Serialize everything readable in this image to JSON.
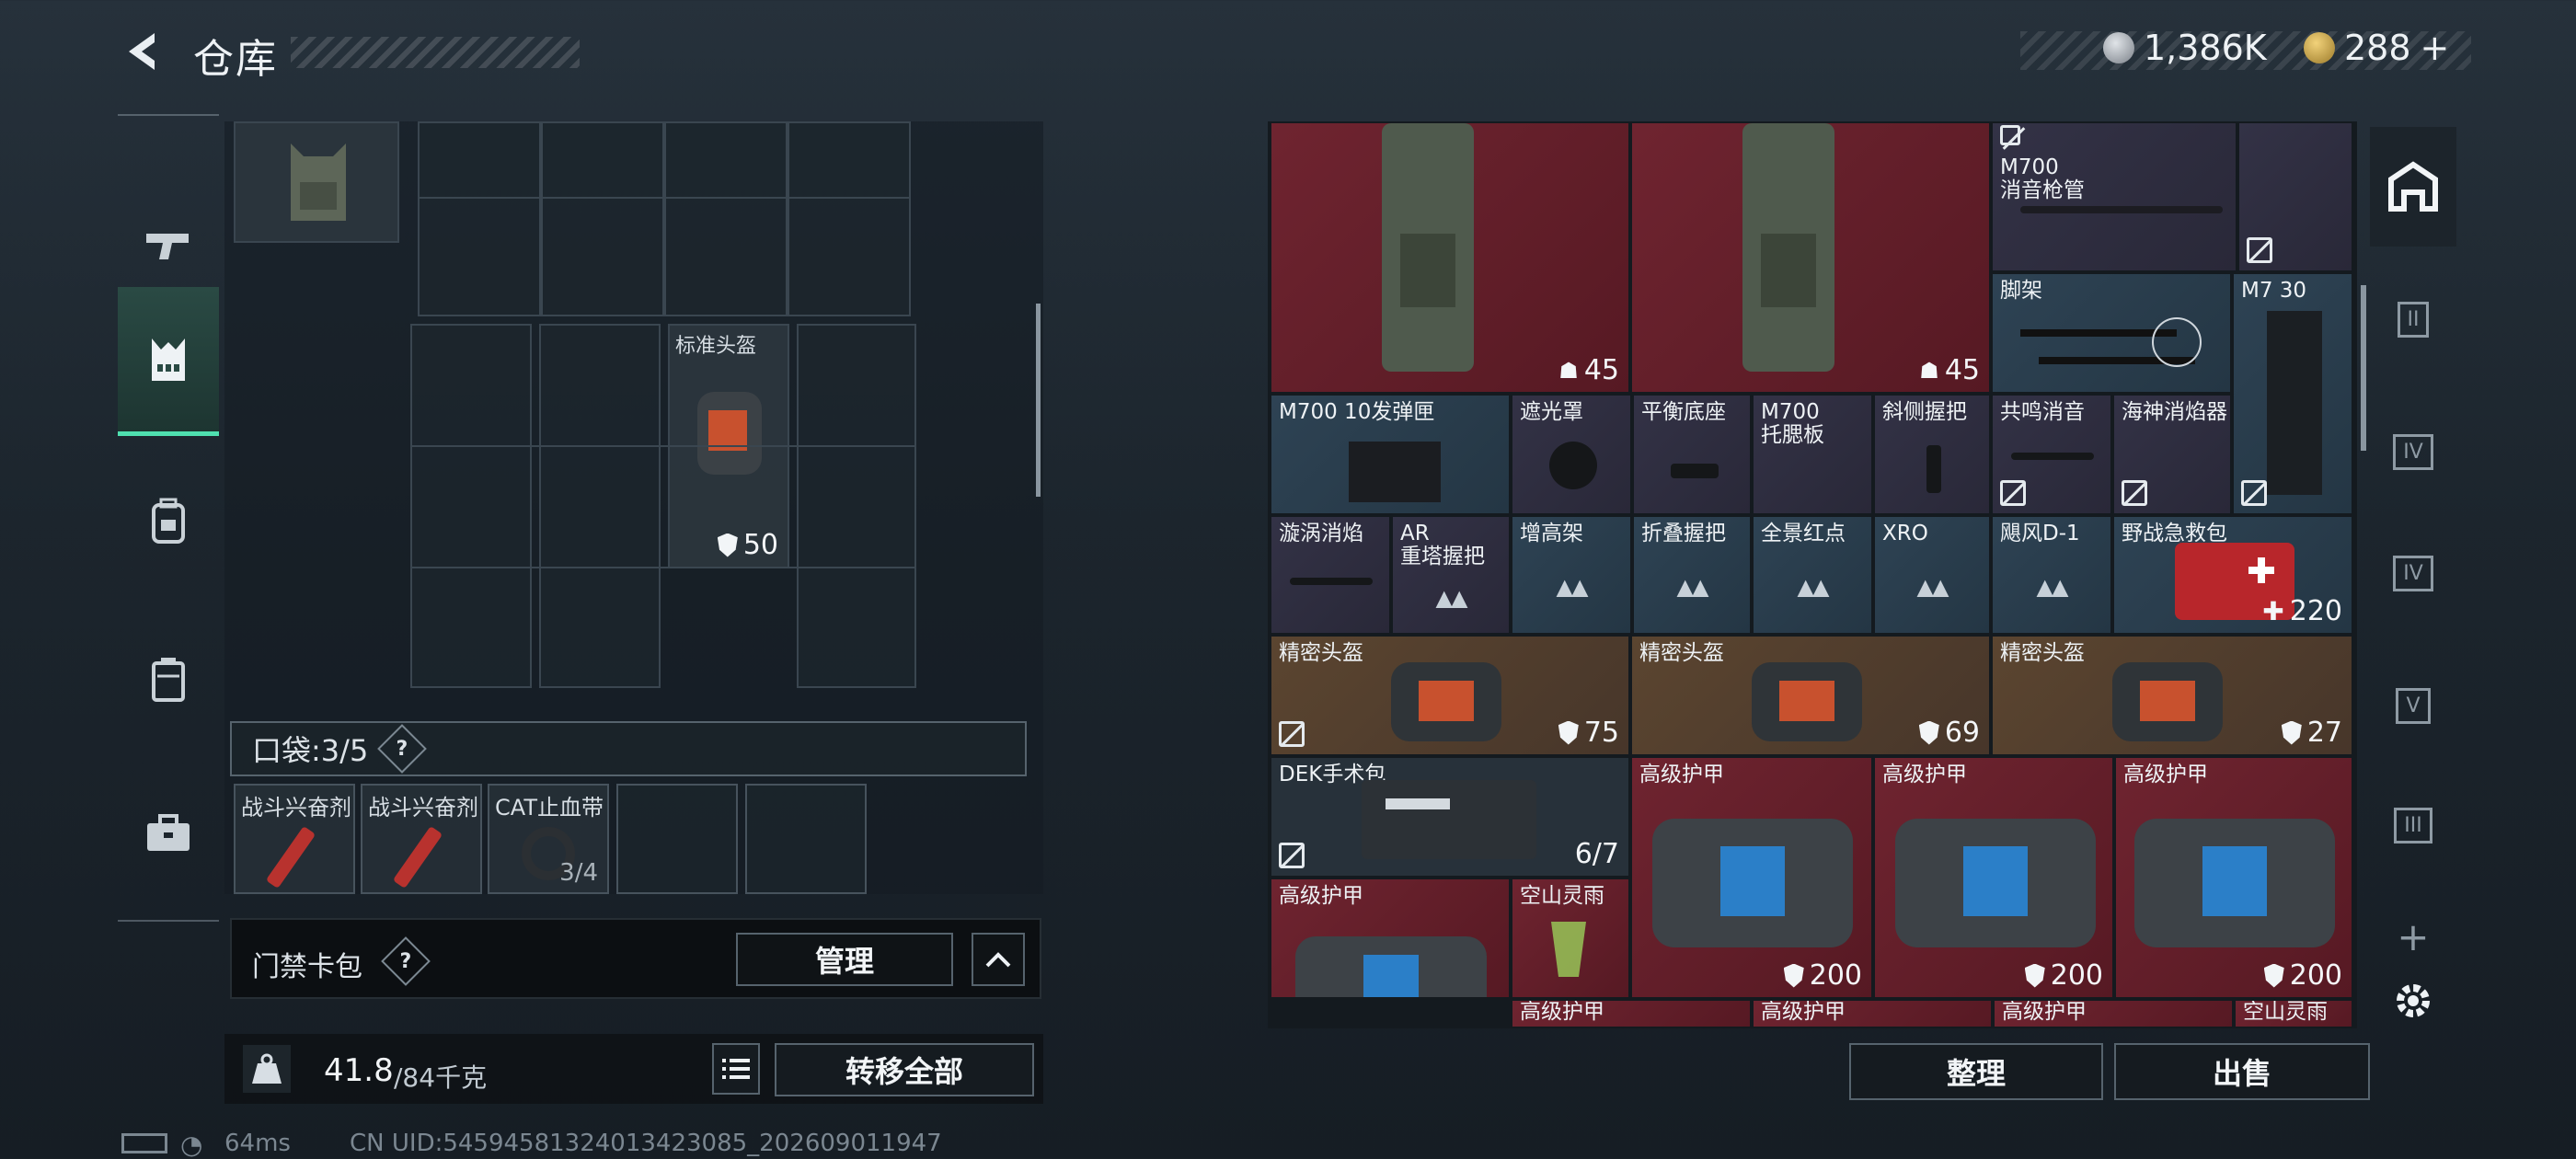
{
  "header": {
    "title": "仓库",
    "currency1": "1,386K",
    "currency2": "288",
    "plus": "+",
    "colors": {
      "accent": "#4fe0b0"
    }
  },
  "left_rail": [
    "gun-icon",
    "vest-icon",
    "backpack-icon",
    "armor-icon",
    "briefcase-icon"
  ],
  "gear": {
    "helmet_slot_label": "标准头盔",
    "helmet_value": "50",
    "pocket_label": "口袋:",
    "pocket_count": "3/5",
    "help": "?",
    "pockets": [
      {
        "label": "战斗兴奋剂"
      },
      {
        "label": "战斗兴奋剂"
      },
      {
        "label": "CAT止血带",
        "value": "3/4"
      }
    ]
  },
  "card_bar": {
    "label": "门禁卡包",
    "help": "?",
    "manage": "管理"
  },
  "weight": {
    "current": "41.8",
    "max": "/84千克"
  },
  "transfer_all": "转移全部",
  "stash": {
    "r1": [
      {
        "value": "45"
      },
      {
        "value": "45"
      },
      {
        "label": "M700\n消音枪管"
      },
      {
        "label": "脚架"
      },
      {
        "label": "M7 30"
      }
    ],
    "r2": [
      {
        "label": "M700 10发弹匣"
      },
      {
        "label": "遮光罩"
      },
      {
        "label": "平衡底座"
      },
      {
        "label": "M700\n托腮板"
      },
      {
        "label": "斜侧握把"
      },
      {
        "label": "共鸣消音"
      },
      {
        "label": "海神消焰器"
      }
    ],
    "r3": [
      {
        "label": "漩涡消焰"
      },
      {
        "label": "AR\n重塔握把"
      },
      {
        "label": "增高架"
      },
      {
        "label": "折叠握把"
      },
      {
        "label": "全景红点"
      },
      {
        "label": "XRO"
      },
      {
        "label": "飓风D-1"
      },
      {
        "label": "野战急救包",
        "value": "220"
      }
    ],
    "r4": [
      {
        "label": "精密头盔",
        "value": "75"
      },
      {
        "label": "精密头盔",
        "value": "69"
      },
      {
        "label": "精密头盔",
        "value": "27"
      }
    ],
    "r5": [
      {
        "label": "DEK手术包",
        "value": "6/7"
      },
      {
        "label": "高级护甲",
        "value": "200"
      },
      {
        "label": "高级护甲",
        "value": "200"
      },
      {
        "label": "高级护甲",
        "value": "200"
      }
    ],
    "r6": [
      {
        "label": "高级护甲"
      },
      {
        "label": "空山灵雨"
      }
    ],
    "r7": [
      {
        "label": "高级护甲"
      },
      {
        "label": "高级护甲"
      },
      {
        "label": "高级护甲"
      },
      {
        "label": "空山灵雨"
      }
    ]
  },
  "sort_button": "整理",
  "sell_button": "出售",
  "right_rail": [
    "home-icon",
    "II",
    "IV",
    "IV",
    "V",
    "III",
    "+"
  ],
  "footer": {
    "ping": "64ms",
    "uid": "CN UID:5459458132401342​3085_202609011947"
  }
}
